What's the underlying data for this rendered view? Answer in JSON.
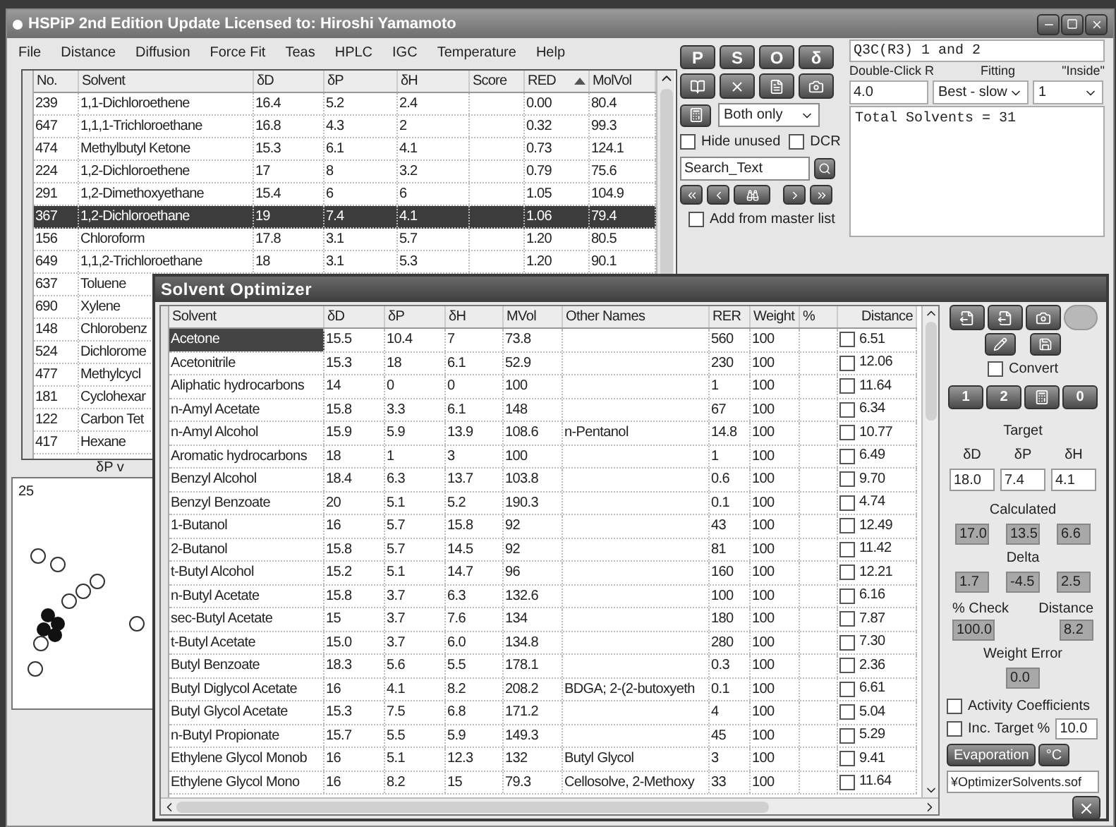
{
  "window": {
    "title": "HSPiP 2nd Edition Update Licensed to: Hiroshi Yamamoto"
  },
  "menu": [
    "File",
    "Distance",
    "Diffusion",
    "Force Fit",
    "Teas",
    "HPLC",
    "IGC",
    "Temperature",
    "Help"
  ],
  "solvent_table": {
    "columns": [
      {
        "label": "No.",
        "sorted": false
      },
      {
        "label": "Solvent",
        "sorted": false
      },
      {
        "label": "δD",
        "sorted": false
      },
      {
        "label": "δP",
        "sorted": false
      },
      {
        "label": "δH",
        "sorted": false
      },
      {
        "label": "Score",
        "sorted": false
      },
      {
        "label": "RED",
        "sorted": true
      },
      {
        "label": "MolVol",
        "sorted": false
      }
    ],
    "rows": [
      {
        "no": "239",
        "solvent": "1,1-Dichloroethene",
        "d_d": "16.4",
        "d_p": "5.2",
        "d_h": "2.4",
        "red": "0.00",
        "mol_vol": "80.4",
        "selected": false
      },
      {
        "no": "647",
        "solvent": "1,1,1-Trichloroethane",
        "d_d": "16.8",
        "d_p": "4.3",
        "d_h": "2",
        "red": "0.32",
        "mol_vol": "99.3",
        "selected": false
      },
      {
        "no": "474",
        "solvent": "Methylbutyl Ketone",
        "d_d": "15.3",
        "d_p": "6.1",
        "d_h": "4.1",
        "red": "0.73",
        "mol_vol": "124.1",
        "selected": false
      },
      {
        "no": "224",
        "solvent": "1,2-Dichloroethene",
        "d_d": "17",
        "d_p": "8",
        "d_h": "3.2",
        "red": "0.79",
        "mol_vol": "75.6",
        "selected": false
      },
      {
        "no": "291",
        "solvent": "1,2-Dimethoxyethane",
        "d_d": "15.4",
        "d_p": "6",
        "d_h": "6",
        "red": "1.05",
        "mol_vol": "104.9",
        "selected": false
      },
      {
        "no": "367",
        "solvent": "1,2-Dichloroethane",
        "d_d": "19",
        "d_p": "7.4",
        "d_h": "4.1",
        "red": "1.06",
        "mol_vol": "79.4",
        "selected": true
      },
      {
        "no": "156",
        "solvent": "Chloroform",
        "d_d": "17.8",
        "d_p": "3.1",
        "d_h": "5.7",
        "red": "1.20",
        "mol_vol": "80.5",
        "selected": false
      },
      {
        "no": "649",
        "solvent": "1,1,2-Trichloroethane",
        "d_d": "18",
        "d_p": "3.1",
        "d_h": "5.3",
        "red": "1.20",
        "mol_vol": "90.1",
        "selected": false
      },
      {
        "no": "637",
        "solvent": "Toluene",
        "selected": false
      },
      {
        "no": "690",
        "solvent": "Xylene",
        "selected": false
      },
      {
        "no": "148",
        "solvent": "Chlorobenz",
        "selected": false
      },
      {
        "no": "524",
        "solvent": "Dichlorome",
        "selected": false
      },
      {
        "no": "477",
        "solvent": "Methylcycl",
        "selected": false
      },
      {
        "no": "181",
        "solvent": "Cyclohexar",
        "selected": false
      },
      {
        "no": "122",
        "solvent": "Carbon Tet",
        "selected": false
      },
      {
        "no": "417",
        "solvent": "Hexane",
        "selected": false
      }
    ]
  },
  "plot": {
    "axis_title": "δP v",
    "tick": "25"
  },
  "controls": {
    "letter_buttons": [
      "P",
      "S",
      "O",
      "δ"
    ],
    "filter": "Both only",
    "hide_unused": {
      "label": "Hide unused",
      "checked": false
    },
    "dcr": {
      "label": "DCR",
      "checked": false
    },
    "search": "Search_Text",
    "add_from_master": {
      "label": "Add from master list",
      "checked": false
    }
  },
  "set_panel": {
    "name": "Q3C(R3) 1 and 2",
    "labels": [
      "Double-Click R",
      "Fitting",
      "\"Inside\""
    ],
    "radius": "4.0",
    "fitting": "Best - slow",
    "inside": "1",
    "output": "Total Solvents = 31"
  },
  "optimizer": {
    "title": "Solvent Optimizer",
    "columns": [
      "Solvent",
      "δD",
      "δP",
      "δH",
      "MVol",
      "Other Names",
      "RER",
      "Weight",
      "%",
      "Distance"
    ],
    "rows": [
      {
        "solvent": "Acetone",
        "d_d": "15.5",
        "d_p": "10.4",
        "d_h": "7",
        "m_vol": "73.8",
        "rer": "560",
        "weight": "100",
        "distance": "6.51",
        "checked": false,
        "selected": true
      },
      {
        "solvent": "Acetonitrile",
        "d_d": "15.3",
        "d_p": "18",
        "d_h": "6.1",
        "m_vol": "52.9",
        "rer": "230",
        "weight": "100",
        "distance": "12.06",
        "checked": false,
        "selected": false
      },
      {
        "solvent": "Aliphatic hydrocarbons",
        "d_d": "14",
        "d_p": "0",
        "d_h": "0",
        "m_vol": "100",
        "rer": "1",
        "weight": "100",
        "distance": "11.64",
        "checked": false,
        "selected": false
      },
      {
        "solvent": "n-Amyl Acetate",
        "d_d": "15.8",
        "d_p": "3.3",
        "d_h": "6.1",
        "m_vol": "148",
        "rer": "67",
        "weight": "100",
        "distance": "6.34",
        "checked": false,
        "selected": false
      },
      {
        "solvent": "n-Amyl Alcohol",
        "d_d": "15.9",
        "d_p": "5.9",
        "d_h": "13.9",
        "m_vol": "108.6",
        "other_names": "n-Pentanol",
        "rer": "14.8",
        "weight": "100",
        "distance": "10.77",
        "checked": false,
        "selected": false
      },
      {
        "solvent": "Aromatic hydrocarbons",
        "d_d": "18",
        "d_p": "1",
        "d_h": "3",
        "m_vol": "100",
        "rer": "1",
        "weight": "100",
        "distance": "6.49",
        "checked": false,
        "selected": false
      },
      {
        "solvent": "Benzyl Alcohol",
        "d_d": "18.4",
        "d_p": "6.3",
        "d_h": "13.7",
        "m_vol": "103.8",
        "rer": "0.6",
        "weight": "100",
        "distance": "9.70",
        "checked": false,
        "selected": false
      },
      {
        "solvent": "Benzyl Benzoate",
        "d_d": "20",
        "d_p": "5.1",
        "d_h": "5.2",
        "m_vol": "190.3",
        "rer": "0.1",
        "weight": "100",
        "distance": "4.74",
        "checked": false,
        "selected": false
      },
      {
        "solvent": "1-Butanol",
        "d_d": "16",
        "d_p": "5.7",
        "d_h": "15.8",
        "m_vol": "92",
        "rer": "43",
        "weight": "100",
        "distance": "12.49",
        "checked": false,
        "selected": false
      },
      {
        "solvent": "2-Butanol",
        "d_d": "15.8",
        "d_p": "5.7",
        "d_h": "14.5",
        "m_vol": "92",
        "rer": "81",
        "weight": "100",
        "distance": "11.42",
        "checked": false,
        "selected": false
      },
      {
        "solvent": "t-Butyl Alcohol",
        "d_d": "15.2",
        "d_p": "5.1",
        "d_h": "14.7",
        "m_vol": "96",
        "rer": "160",
        "weight": "100",
        "distance": "12.21",
        "checked": false,
        "selected": false
      },
      {
        "solvent": "n-Butyl Acetate",
        "d_d": "15.8",
        "d_p": "3.7",
        "d_h": "6.3",
        "m_vol": "132.6",
        "rer": "100",
        "weight": "100",
        "distance": "6.16",
        "checked": false,
        "selected": false
      },
      {
        "solvent": "sec-Butyl Acetate",
        "d_d": "15",
        "d_p": "3.7",
        "d_h": "7.6",
        "m_vol": "134",
        "rer": "180",
        "weight": "100",
        "distance": "7.87",
        "checked": false,
        "selected": false
      },
      {
        "solvent": "t-Butyl Acetate",
        "d_d": "15.0",
        "d_p": "3.7",
        "d_h": "6.0",
        "m_vol": "134.8",
        "rer": "280",
        "weight": "100",
        "distance": "7.30",
        "checked": false,
        "selected": false
      },
      {
        "solvent": "Butyl Benzoate",
        "d_d": "18.3",
        "d_p": "5.6",
        "d_h": "5.5",
        "m_vol": "178.1",
        "rer": "0.3",
        "weight": "100",
        "distance": "2.36",
        "checked": false,
        "selected": false
      },
      {
        "solvent": "Butyl Diglycol Acetate",
        "d_d": "16",
        "d_p": "4.1",
        "d_h": "8.2",
        "m_vol": "208.2",
        "other_names": "BDGA; 2-(2-butoxyeth",
        "rer": "0.1",
        "weight": "100",
        "distance": "6.61",
        "checked": false,
        "selected": false
      },
      {
        "solvent": "Butyl Glycol Acetate",
        "d_d": "15.3",
        "d_p": "7.5",
        "d_h": "6.8",
        "m_vol": "171.2",
        "rer": "4",
        "weight": "100",
        "distance": "5.04",
        "checked": false,
        "selected": false
      },
      {
        "solvent": "n-Butyl Propionate",
        "d_d": "15.7",
        "d_p": "5.5",
        "d_h": "5.9",
        "m_vol": "149.3",
        "rer": "45",
        "weight": "100",
        "distance": "5.29",
        "checked": false,
        "selected": false
      },
      {
        "solvent": "Ethylene Glycol Monob",
        "d_d": "16",
        "d_p": "5.1",
        "d_h": "12.3",
        "m_vol": "132",
        "other_names": "Butyl Glycol",
        "rer": "3",
        "weight": "100",
        "distance": "9.41",
        "checked": false,
        "selected": false
      },
      {
        "solvent": "Ethylene Glycol Mono",
        "d_d": "16",
        "d_p": "8.2",
        "d_h": "15",
        "m_vol": "79.3",
        "other_names": "Cellosolve, 2-Methoxy",
        "rer": "33",
        "weight": "100",
        "distance": "11.64",
        "checked": false,
        "selected": false
      }
    ],
    "convert": {
      "label": "Convert",
      "checked": false
    },
    "mode_buttons": [
      {
        "kind": "text",
        "label": "1"
      },
      {
        "kind": "text",
        "label": "2"
      },
      {
        "kind": "calculator"
      },
      {
        "kind": "text",
        "label": "0"
      }
    ],
    "target": {
      "title": "Target",
      "labels": [
        "δD",
        "δP",
        "δH"
      ],
      "values": [
        "18.0",
        "7.4",
        "4.1"
      ]
    },
    "calculated": {
      "title": "Calculated",
      "values": [
        "17.0",
        "13.5",
        "6.6"
      ]
    },
    "delta": {
      "title": "Delta",
      "values": [
        "1.7",
        "-4.5",
        "2.5"
      ]
    },
    "check": {
      "label": "% Check",
      "value": "100.0"
    },
    "distance": {
      "label": "Distance",
      "value": "8.2"
    },
    "weight_error": {
      "label": "Weight Error",
      "value": "0.0"
    },
    "activity_coefficients": {
      "label": "Activity Coefficients",
      "checked": false
    },
    "inc_target": {
      "label": "Inc. Target %",
      "checked": false,
      "value": "10.0"
    },
    "buttons": [
      "Evaporation",
      "°C"
    ],
    "file": "¥OptimizerSolvents.sof"
  }
}
